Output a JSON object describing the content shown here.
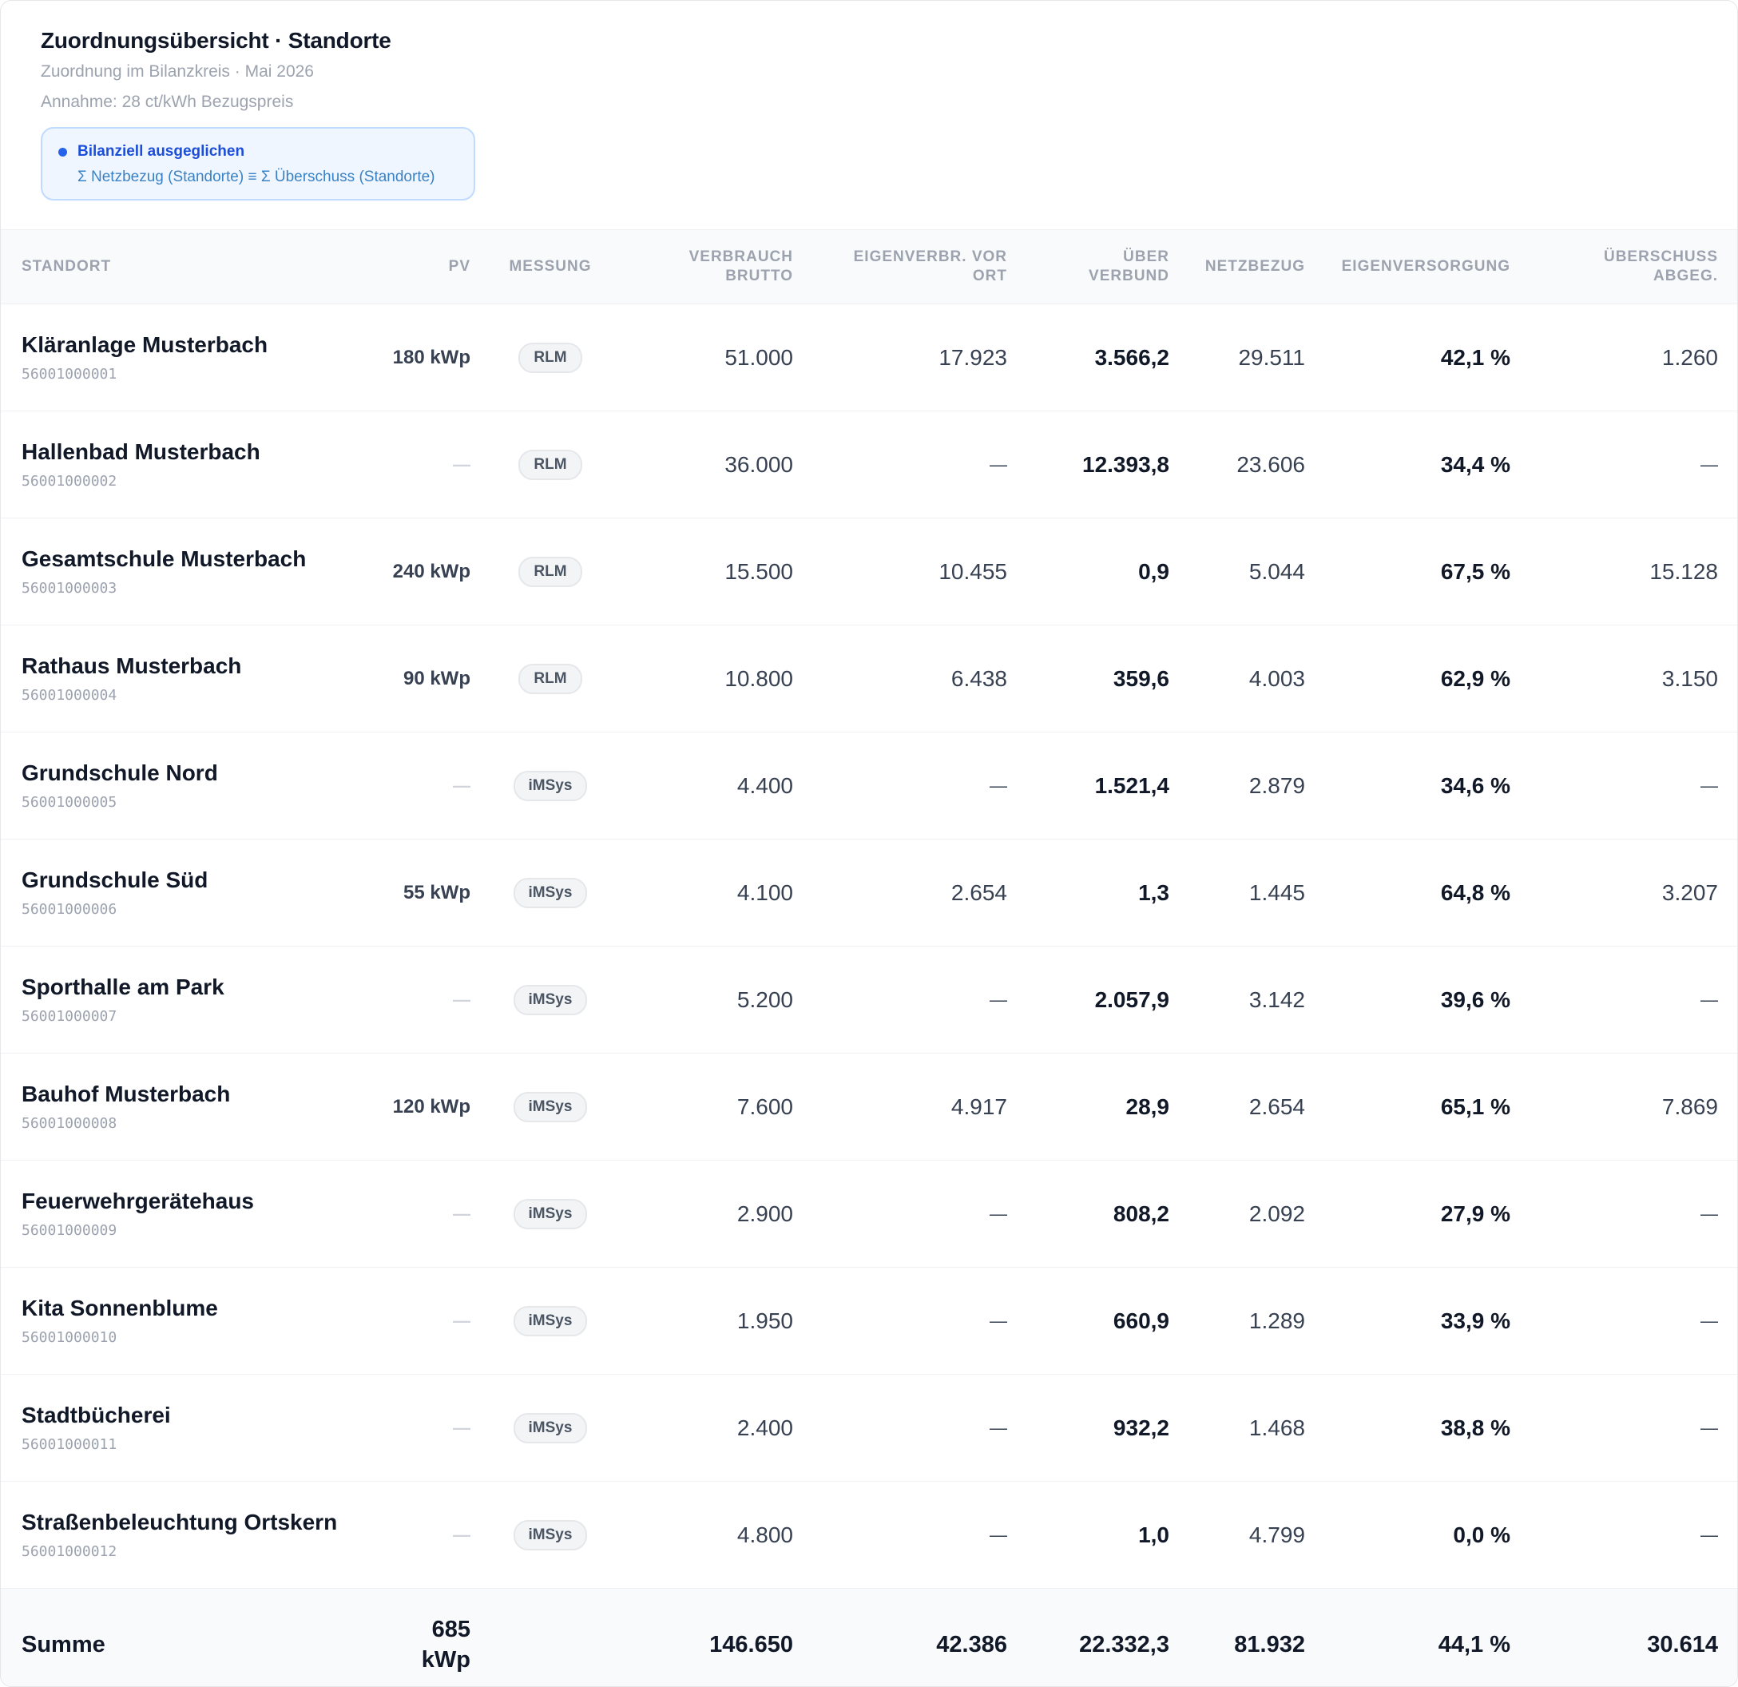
{
  "header": {
    "title": "Zuordnungsübersicht · Standorte",
    "subtitle": "Zuordnung im Bilanzkreis · Mai 2026",
    "assumption": "Annahme: 28 ct/kWh Bezugspreis"
  },
  "status": {
    "label": "Bilanziell ausgeglichen",
    "formula": "Σ Netzbezug (Standorte) ≡ Σ Überschuss (Standorte)",
    "color": "#2563eb"
  },
  "columns": {
    "site": "STANDORT",
    "pv": "PV",
    "measurement": "MESSUNG",
    "consumption": "VERBRAUCH\nBRUTTO",
    "self_consumption": "EIGENVERBR. VOR\nORT",
    "via_network": "ÜBER\nVERBUND",
    "grid": "NETZBEZUG",
    "self_supply": "EIGENVERSORGUNG",
    "surplus": "ÜBERSCHUSS\nABGEG."
  },
  "rows": [
    {
      "name": "Kläranlage Musterbach",
      "id": "56001000001",
      "pv": "180 kWp",
      "measurement": "RLM",
      "consumption": "51.000",
      "self_consumption": "17.923",
      "via_network": "3.566,2",
      "grid": "29.511",
      "self_supply": "42,1 %",
      "surplus": "1.260"
    },
    {
      "name": "Hallenbad Musterbach",
      "id": "56001000002",
      "pv": "—",
      "measurement": "RLM",
      "consumption": "36.000",
      "self_consumption": "—",
      "via_network": "12.393,8",
      "grid": "23.606",
      "self_supply": "34,4 %",
      "surplus": "—"
    },
    {
      "name": "Gesamtschule Musterbach",
      "id": "56001000003",
      "pv": "240 kWp",
      "measurement": "RLM",
      "consumption": "15.500",
      "self_consumption": "10.455",
      "via_network": "0,9",
      "grid": "5.044",
      "self_supply": "67,5 %",
      "surplus": "15.128"
    },
    {
      "name": "Rathaus Musterbach",
      "id": "56001000004",
      "pv": "90 kWp",
      "measurement": "RLM",
      "consumption": "10.800",
      "self_consumption": "6.438",
      "via_network": "359,6",
      "grid": "4.003",
      "self_supply": "62,9 %",
      "surplus": "3.150"
    },
    {
      "name": "Grundschule Nord",
      "id": "56001000005",
      "pv": "—",
      "measurement": "iMSys",
      "consumption": "4.400",
      "self_consumption": "—",
      "via_network": "1.521,4",
      "grid": "2.879",
      "self_supply": "34,6 %",
      "surplus": "—"
    },
    {
      "name": "Grundschule Süd",
      "id": "56001000006",
      "pv": "55 kWp",
      "measurement": "iMSys",
      "consumption": "4.100",
      "self_consumption": "2.654",
      "via_network": "1,3",
      "grid": "1.445",
      "self_supply": "64,8 %",
      "surplus": "3.207"
    },
    {
      "name": "Sporthalle am Park",
      "id": "56001000007",
      "pv": "—",
      "measurement": "iMSys",
      "consumption": "5.200",
      "self_consumption": "—",
      "via_network": "2.057,9",
      "grid": "3.142",
      "self_supply": "39,6 %",
      "surplus": "—"
    },
    {
      "name": "Bauhof Musterbach",
      "id": "56001000008",
      "pv": "120 kWp",
      "measurement": "iMSys",
      "consumption": "7.600",
      "self_consumption": "4.917",
      "via_network": "28,9",
      "grid": "2.654",
      "self_supply": "65,1 %",
      "surplus": "7.869"
    },
    {
      "name": "Feuerwehrgerätehaus",
      "id": "56001000009",
      "pv": "—",
      "measurement": "iMSys",
      "consumption": "2.900",
      "self_consumption": "—",
      "via_network": "808,2",
      "grid": "2.092",
      "self_supply": "27,9 %",
      "surplus": "—"
    },
    {
      "name": "Kita Sonnenblume",
      "id": "56001000010",
      "pv": "—",
      "measurement": "iMSys",
      "consumption": "1.950",
      "self_consumption": "—",
      "via_network": "660,9",
      "grid": "1.289",
      "self_supply": "33,9 %",
      "surplus": "—"
    },
    {
      "name": "Stadtbücherei",
      "id": "56001000011",
      "pv": "—",
      "measurement": "iMSys",
      "consumption": "2.400",
      "self_consumption": "—",
      "via_network": "932,2",
      "grid": "1.468",
      "self_supply": "38,8 %",
      "surplus": "—"
    },
    {
      "name": "Straßenbeleuchtung Ortskern",
      "id": "56001000012",
      "pv": "—",
      "measurement": "iMSys",
      "consumption": "4.800",
      "self_consumption": "—",
      "via_network": "1,0",
      "grid": "4.799",
      "self_supply": "0,0 %",
      "surplus": "—"
    }
  ],
  "totals": {
    "label": "Summe",
    "pv": "685\nkWp",
    "consumption": "146.650",
    "self_consumption": "42.386",
    "via_network": "22.332,3",
    "grid": "81.932",
    "self_supply": "44,1 %",
    "surplus": "30.614"
  }
}
